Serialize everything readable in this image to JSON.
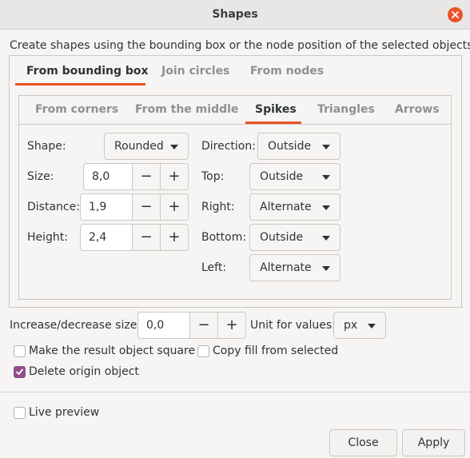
{
  "window": {
    "title": "Shapes"
  },
  "description": "Create shapes using the bounding box or the node position of the selected objects",
  "main_tabs": [
    "From bounding box",
    "Join circles",
    "From nodes"
  ],
  "sub_tabs": [
    "From corners",
    "From the middle",
    "Spikes",
    "Triangles",
    "Arrows"
  ],
  "spikes": {
    "shape_label": "Shape:",
    "shape_value": "Rounded",
    "size_label": "Size:",
    "size_value": "8,0",
    "distance_label": "Distance:",
    "distance_value": "1,9",
    "height_label": "Height:",
    "height_value": "2,4",
    "direction_label": "Direction:",
    "direction_value": "Outside",
    "top_label": "Top:",
    "top_value": "Outside",
    "right_label": "Right:",
    "right_value": "Alternate",
    "bottom_label": "Bottom:",
    "bottom_value": "Outside",
    "left_label": "Left:",
    "left_value": "Alternate"
  },
  "controls": {
    "increase_label": "Increase/decrease size:",
    "increase_value": "0,0",
    "unit_label": "Unit for values:",
    "unit_value": "px",
    "minus": "−",
    "plus": "+"
  },
  "options": {
    "square_label": "Make the result object square",
    "square_checked": false,
    "copy_fill_label": "Copy fill from selected",
    "copy_fill_checked": false,
    "delete_origin_label": "Delete origin object",
    "delete_origin_checked": true,
    "live_preview_label": "Live preview",
    "live_preview_checked": false
  },
  "buttons": {
    "close": "Close",
    "apply": "Apply"
  },
  "colors": {
    "accent": "#e95420",
    "check": "#924d8b",
    "close_button": "#e9542b"
  }
}
